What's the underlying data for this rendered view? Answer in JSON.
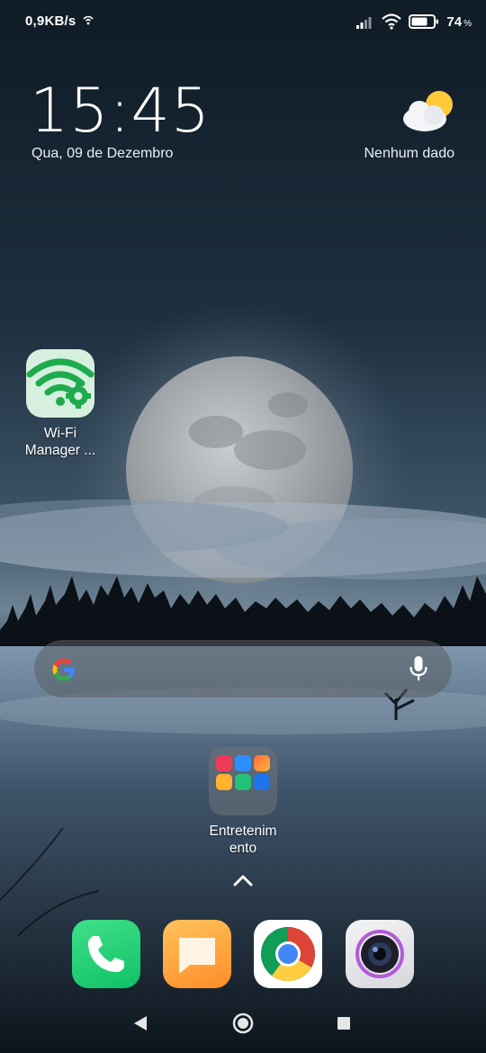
{
  "status_bar": {
    "net_speed": "0,9KB/s",
    "battery_percent": "74",
    "battery_unit": "%",
    "battery_level": 0.74,
    "icons": [
      "network-activity-icon",
      "signal-icon",
      "wifi-icon",
      "battery-icon"
    ]
  },
  "clock_widget": {
    "time": "15:45",
    "date": "Qua, 09 de Dezembro"
  },
  "weather_widget": {
    "icon": "partly-cloudy-icon",
    "text": "Nenhum dado"
  },
  "apps": {
    "wifi_manager": {
      "label": "Wi-Fi Manager ...",
      "icon": "wifi-gear-icon",
      "color": "#1faa4e"
    }
  },
  "search_bar": {
    "logo": "google-g-icon",
    "mic": "microphone-icon"
  },
  "folder": {
    "label": "Entretenimento",
    "mini_icons": [
      "tiktok",
      "messenger",
      "copilot",
      "notes",
      "safety",
      "shazam"
    ]
  },
  "dock": [
    {
      "name": "phone",
      "icon": "phone-icon"
    },
    {
      "name": "messages",
      "icon": "message-icon"
    },
    {
      "name": "chrome",
      "icon": "chrome-icon"
    },
    {
      "name": "camera",
      "icon": "camera-icon"
    }
  ],
  "nav_bar": [
    "back",
    "home",
    "recents"
  ],
  "colors": {
    "sky_top": "#0f1c27",
    "moon": "#b8bcc0",
    "search_bar_bg": "#5a5f64",
    "phone_green": "#16c56c",
    "message_orange": "#ffa53a"
  }
}
